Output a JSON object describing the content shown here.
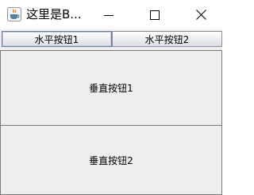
{
  "window": {
    "title": "这里是B...",
    "icon": "java-coffee-cup-icon",
    "controls": [
      "minimize-icon",
      "maximize-icon",
      "close-icon"
    ]
  },
  "horizontal_buttons": [
    {
      "label": "水平按钮1"
    },
    {
      "label": "水平按钮2"
    }
  ],
  "vertical_buttons": [
    {
      "label": "垂直按钮1"
    },
    {
      "label": "垂直按钮2"
    }
  ],
  "colors": {
    "content_background": "#eeeeee",
    "focus_ring": "#b8cfe5",
    "java_cup_red": "#e76f00",
    "java_cup_blue": "#5382a1"
  }
}
